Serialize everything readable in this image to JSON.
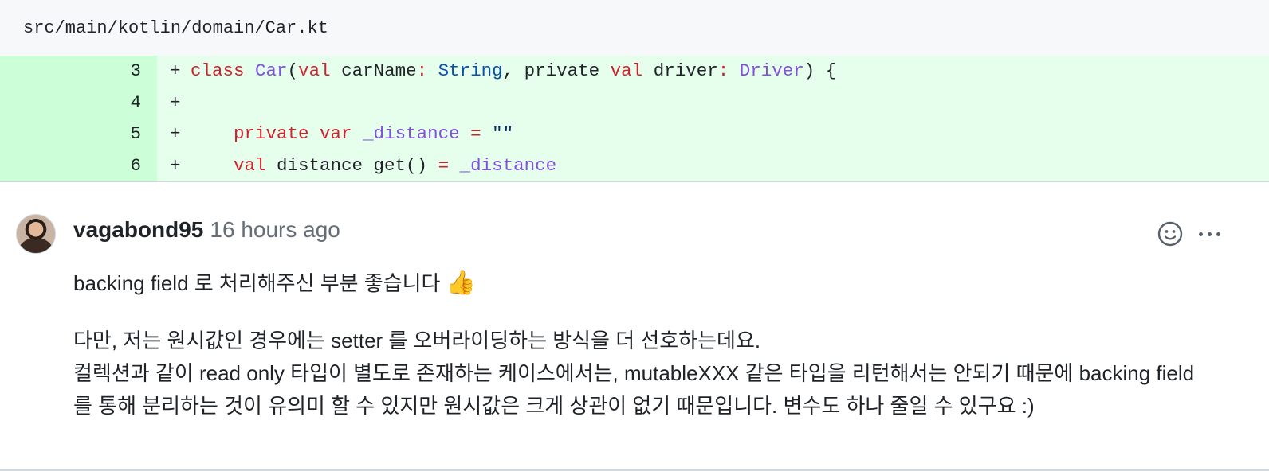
{
  "file": {
    "path": "src/main/kotlin/domain/Car.kt"
  },
  "diff": {
    "marker": "+",
    "lines": [
      {
        "number": "3"
      },
      {
        "number": "4"
      },
      {
        "number": "5"
      },
      {
        "number": "6"
      }
    ],
    "tokens": {
      "l3_class": "class",
      "l3_car": "Car",
      "l3_paren_open": "(",
      "l3_val1": "val",
      "l3_carname": " carName",
      "l3_colon1": ":",
      "l3_string": " String",
      "l3_comma_private": ", private ",
      "l3_val2": "val",
      "l3_driver": " driver",
      "l3_colon2": ":",
      "l3_driver_type": " Driver",
      "l3_end": ") {",
      "l5_private": "private",
      "l5_var": "var",
      "l5_distance": "_distance",
      "l5_eq": "=",
      "l5_str": "\"\"",
      "l6_val": "val",
      "l6_distance_get": " distance get()",
      "l6_eq": "=",
      "l6_backing": "_distance"
    }
  },
  "comment": {
    "author": "vagabond95",
    "timestamp": "16 hours ago",
    "icons": {
      "reaction": "smiley-icon",
      "more": "kebab-icon"
    },
    "paragraph1_text": "backing field 로 처리해주신 부분 좋습니다 ",
    "paragraph1_emoji": "👍",
    "paragraph2_line1": "다만, 저는 원시값인 경우에는 setter 를 오버라이딩하는 방식을 더 선호하는데요.",
    "paragraph2_line2": "컬렉션과 같이 read only 타입이 별도로 존재하는 케이스에서는, mutableXXX 같은 타입을 리턴해서는 안되기 때문에 backing field 를 통해 분리하는 것이 유의미 할 수 있지만 원시값은 크게 상관이 없기 때문입니다. 변수도 하나 줄일 수 있구요 :)"
  },
  "colors": {
    "added_code_bg": "#e6ffec",
    "added_num_bg": "#ccffd8",
    "keyword": "#cf222e",
    "type": "#8250df",
    "builtin": "#0550ae"
  }
}
